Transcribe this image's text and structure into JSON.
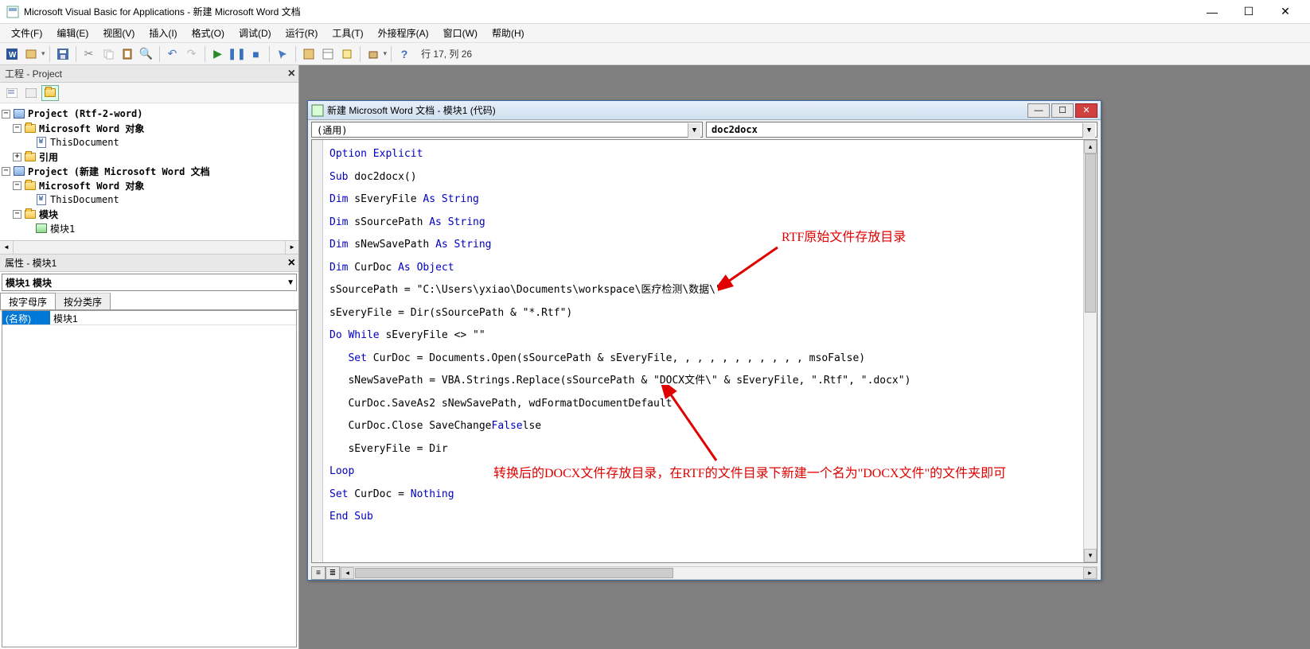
{
  "window": {
    "title": "Microsoft Visual Basic for Applications - 新建 Microsoft Word 文档"
  },
  "menu": {
    "file": "文件(F)",
    "edit": "编辑(E)",
    "view": "视图(V)",
    "insert": "插入(I)",
    "format": "格式(O)",
    "debug": "调试(D)",
    "run": "运行(R)",
    "tools": "工具(T)",
    "addins": "外接程序(A)",
    "window": "窗口(W)",
    "help": "帮助(H)"
  },
  "toolbar": {
    "status": "行 17, 列 26"
  },
  "project_pane": {
    "title": "工程 - Project",
    "tree": {
      "p1": "Project (Rtf-2-word)",
      "p1_wordobj": "Microsoft Word 对象",
      "p1_thisdoc": "ThisDocument",
      "p1_refs": "引用",
      "p2": "Project (新建 Microsoft Word 文档",
      "p2_wordobj": "Microsoft Word 对象",
      "p2_thisdoc": "ThisDocument",
      "p2_modules": "模块",
      "p2_mod1": "模块1"
    }
  },
  "props_pane": {
    "title": "属性 - 模块1",
    "object": "模块1 模块",
    "tab_alpha": "按字母序",
    "tab_cat": "按分类序",
    "row_name_key": "(名称)",
    "row_name_val": "模块1"
  },
  "code_window": {
    "title": "新建 Microsoft Word 文档 - 模块1 (代码)",
    "dd_left": "(通用)",
    "dd_right": "doc2docx",
    "code_lines": [
      {
        "t": "Option Explicit",
        "k": [
          [
            "Option Explicit",
            0
          ]
        ]
      },
      {
        "t": "Sub doc2docx()",
        "k": [
          [
            "Sub",
            0
          ]
        ]
      },
      {
        "t": "Dim sEveryFile As String",
        "k": [
          [
            "Dim",
            0
          ],
          [
            "As String",
            15
          ]
        ]
      },
      {
        "t": "Dim sSourcePath As String",
        "k": [
          [
            "Dim",
            0
          ],
          [
            "As String",
            16
          ]
        ]
      },
      {
        "t": "Dim sNewSavePath As String",
        "k": [
          [
            "Dim",
            0
          ],
          [
            "As String",
            17
          ]
        ]
      },
      {
        "t": "Dim CurDoc As Object",
        "k": [
          [
            "Dim",
            0
          ],
          [
            "As Object",
            11
          ]
        ]
      },
      {
        "t": "sSourcePath = \"C:\\Users\\yxiao\\Documents\\workspace\\医疗检测\\数据\\\"",
        "k": []
      },
      {
        "t": "sEveryFile = Dir(sSourcePath & \"*.Rtf\")",
        "k": []
      },
      {
        "t": "Do While sEveryFile <> \"\"",
        "k": [
          [
            "Do While",
            0
          ]
        ]
      },
      {
        "t": "   Set CurDoc = Documents.Open(sSourcePath & sEveryFile, , , , , , , , , , , msoFalse)",
        "k": [
          [
            "Set",
            3
          ]
        ]
      },
      {
        "t": "   sNewSavePath = VBA.Strings.Replace(sSourcePath & \"DOCX文件\\\" & sEveryFile, \".Rtf\", \".docx\")",
        "k": []
      },
      {
        "t": "   CurDoc.SaveAs2 sNewSavePath, wdFormatDocumentDefault",
        "k": []
      },
      {
        "t": "   CurDoc.Close SaveChanges:=False",
        "k": [
          [
            "False",
            26
          ]
        ]
      },
      {
        "t": "   sEveryFile = Dir",
        "k": []
      },
      {
        "t": "Loop",
        "k": [
          [
            "Loop",
            0
          ]
        ]
      },
      {
        "t": "Set CurDoc = Nothing",
        "k": [
          [
            "Set",
            0
          ],
          [
            "Nothing",
            13
          ]
        ]
      },
      {
        "t": "End Sub",
        "k": [
          [
            "End Sub",
            0
          ]
        ]
      }
    ]
  },
  "annotations": {
    "a1": "RTF原始文件存放目录",
    "a2": "转换后的DOCX文件存放目录，在RTF的文件目录下新建一个名为\"DOCX文件\"的文件夹即可"
  }
}
